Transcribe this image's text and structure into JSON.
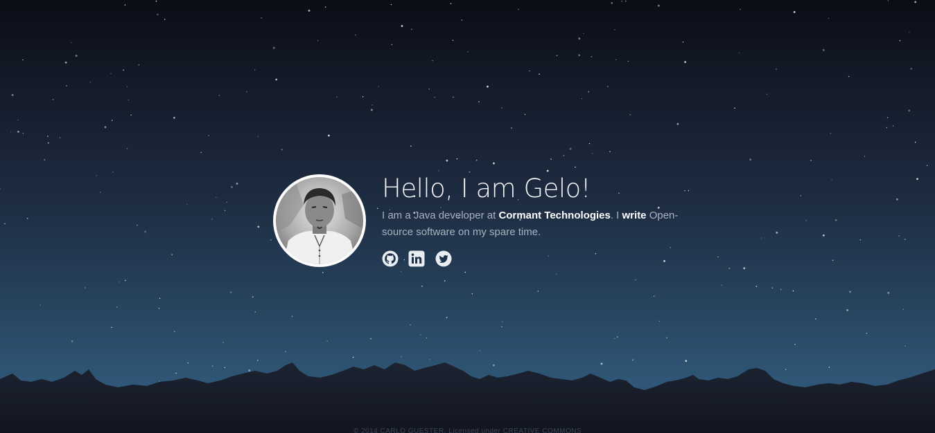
{
  "hero": {
    "heading": "Hello, I am Gelo!",
    "bio_intro": "I am a Java developer at ",
    "company_link": "Cormant Technologies",
    "bio_middle": ". I ",
    "write_link": "write",
    "bio_end": " Open-source software on my spare time."
  },
  "social": [
    {
      "name": "github",
      "icon": "github-icon"
    },
    {
      "name": "linkedin",
      "icon": "linkedin-icon"
    },
    {
      "name": "twitter",
      "icon": "twitter-icon"
    }
  ],
  "footer": {
    "text": "© 2014 CARLO GUESTER. Licensed under CREATIVE COMMONS"
  },
  "colors": {
    "sky_top": "#0b0d16",
    "sky_bottom": "#2f5676",
    "mountains": "#181d28",
    "link": "#ffffff",
    "text_muted": "#a8b3c0"
  }
}
